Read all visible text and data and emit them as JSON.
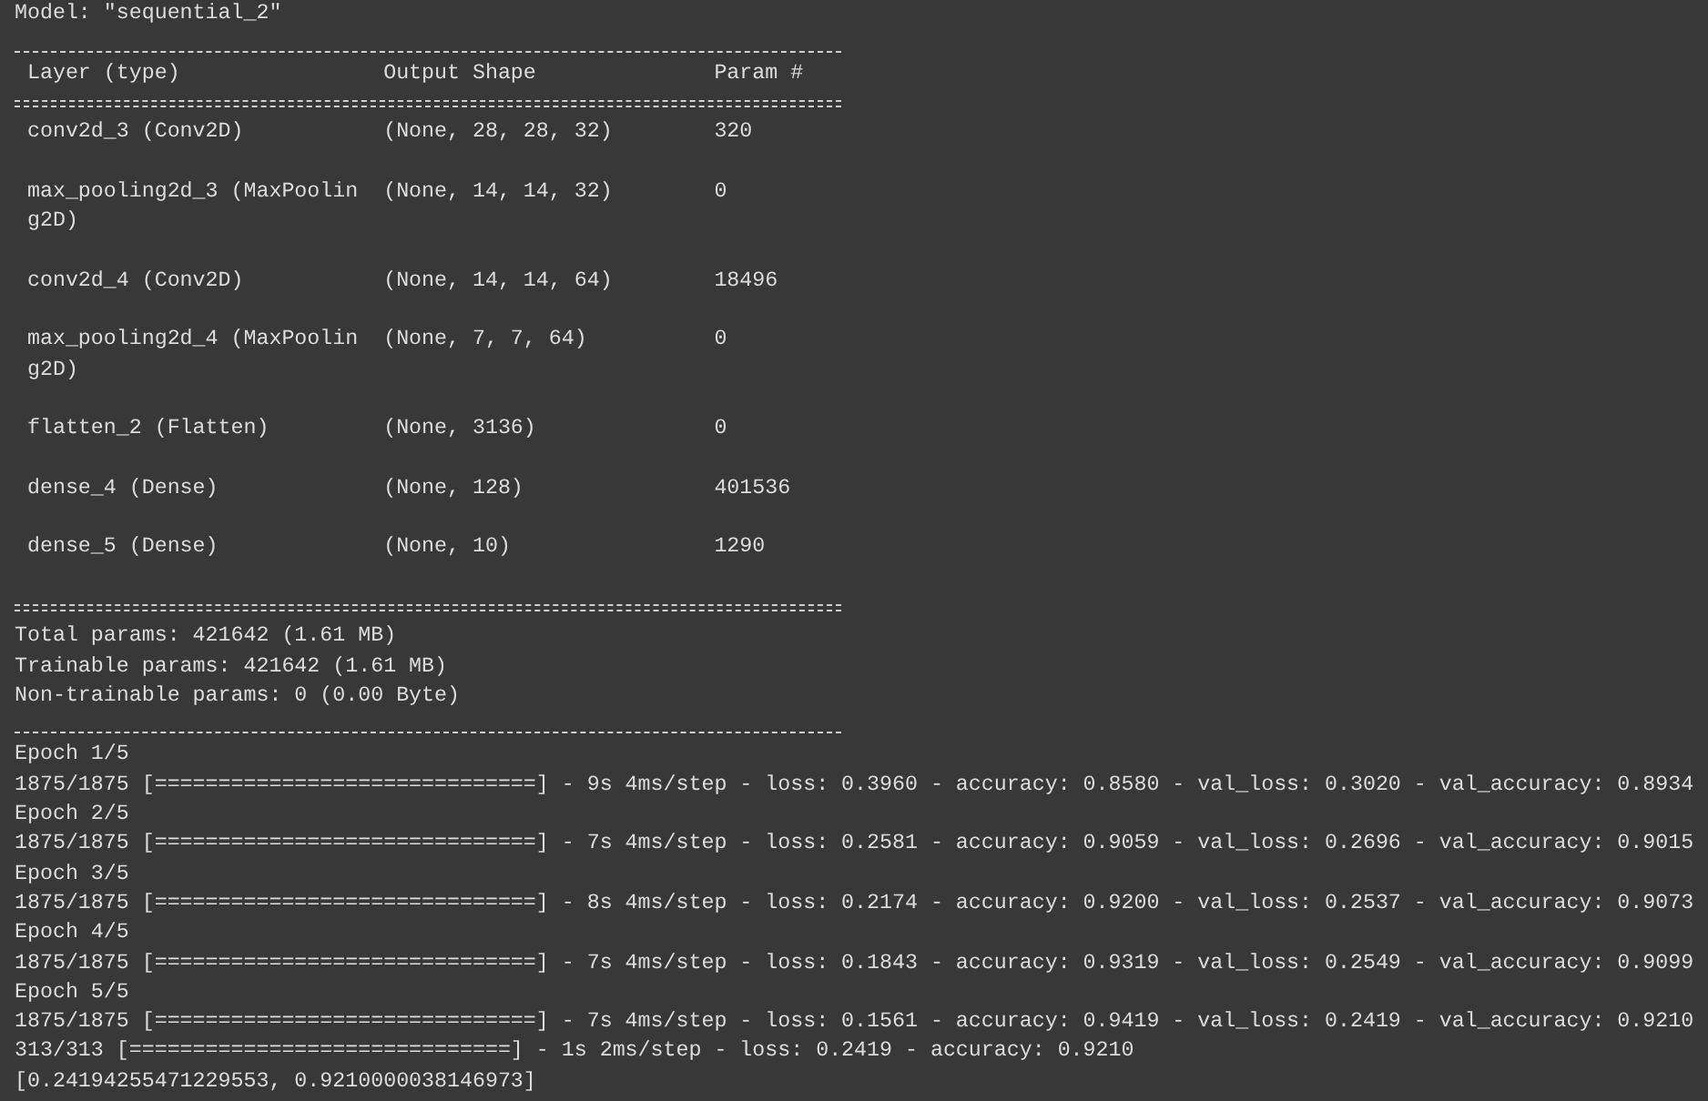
{
  "model_line": "Model: \"sequential_2\"",
  "summary": {
    "columns": [
      "Layer (type)",
      "Output Shape",
      "Param #"
    ],
    "rows": [
      {
        "layer": [
          "conv2d_3 (Conv2D)"
        ],
        "output_shape": "(None, 28, 28, 32)",
        "params": "320"
      },
      {
        "layer": [
          "max_pooling2d_3 (MaxPoolin",
          "g2D)"
        ],
        "output_shape": "(None, 14, 14, 32)",
        "params": "0"
      },
      {
        "layer": [
          "conv2d_4 (Conv2D)"
        ],
        "output_shape": "(None, 14, 14, 64)",
        "params": "18496"
      },
      {
        "layer": [
          "max_pooling2d_4 (MaxPoolin",
          "g2D)"
        ],
        "output_shape": "(None, 7, 7, 64)",
        "params": "0"
      },
      {
        "layer": [
          "flatten_2 (Flatten)"
        ],
        "output_shape": "(None, 3136)",
        "params": "0"
      },
      {
        "layer": [
          "dense_4 (Dense)"
        ],
        "output_shape": "(None, 128)",
        "params": "401536"
      },
      {
        "layer": [
          "dense_5 (Dense)"
        ],
        "output_shape": "(None, 10)",
        "params": "1290"
      }
    ],
    "totals": [
      "Total params: 421642 (1.61 MB)",
      "Trainable params: 421642 (1.61 MB)",
      "Non-trainable params: 0 (0.00 Byte)"
    ]
  },
  "epochs": [
    {
      "label": "Epoch 1/5",
      "log": "1875/1875 [==============================] - 9s 4ms/step - loss: 0.3960 - accuracy: 0.8580 - val_loss: 0.3020 - val_accuracy: 0.8934"
    },
    {
      "label": "Epoch 2/5",
      "log": "1875/1875 [==============================] - 7s 4ms/step - loss: 0.2581 - accuracy: 0.9059 - val_loss: 0.2696 - val_accuracy: 0.9015"
    },
    {
      "label": "Epoch 3/5",
      "log": "1875/1875 [==============================] - 8s 4ms/step - loss: 0.2174 - accuracy: 0.9200 - val_loss: 0.2537 - val_accuracy: 0.9073"
    },
    {
      "label": "Epoch 4/5",
      "log": "1875/1875 [==============================] - 7s 4ms/step - loss: 0.1843 - accuracy: 0.9319 - val_loss: 0.2549 - val_accuracy: 0.9099"
    },
    {
      "label": "Epoch 5/5",
      "log": "1875/1875 [==============================] - 7s 4ms/step - loss: 0.1561 - accuracy: 0.9419 - val_loss: 0.2419 - val_accuracy: 0.9210"
    }
  ],
  "evaluation": "313/313 [==============================] - 1s 2ms/step - loss: 0.2419 - accuracy: 0.9210",
  "result": "[0.24194255471229553, 0.9210000038146973]"
}
